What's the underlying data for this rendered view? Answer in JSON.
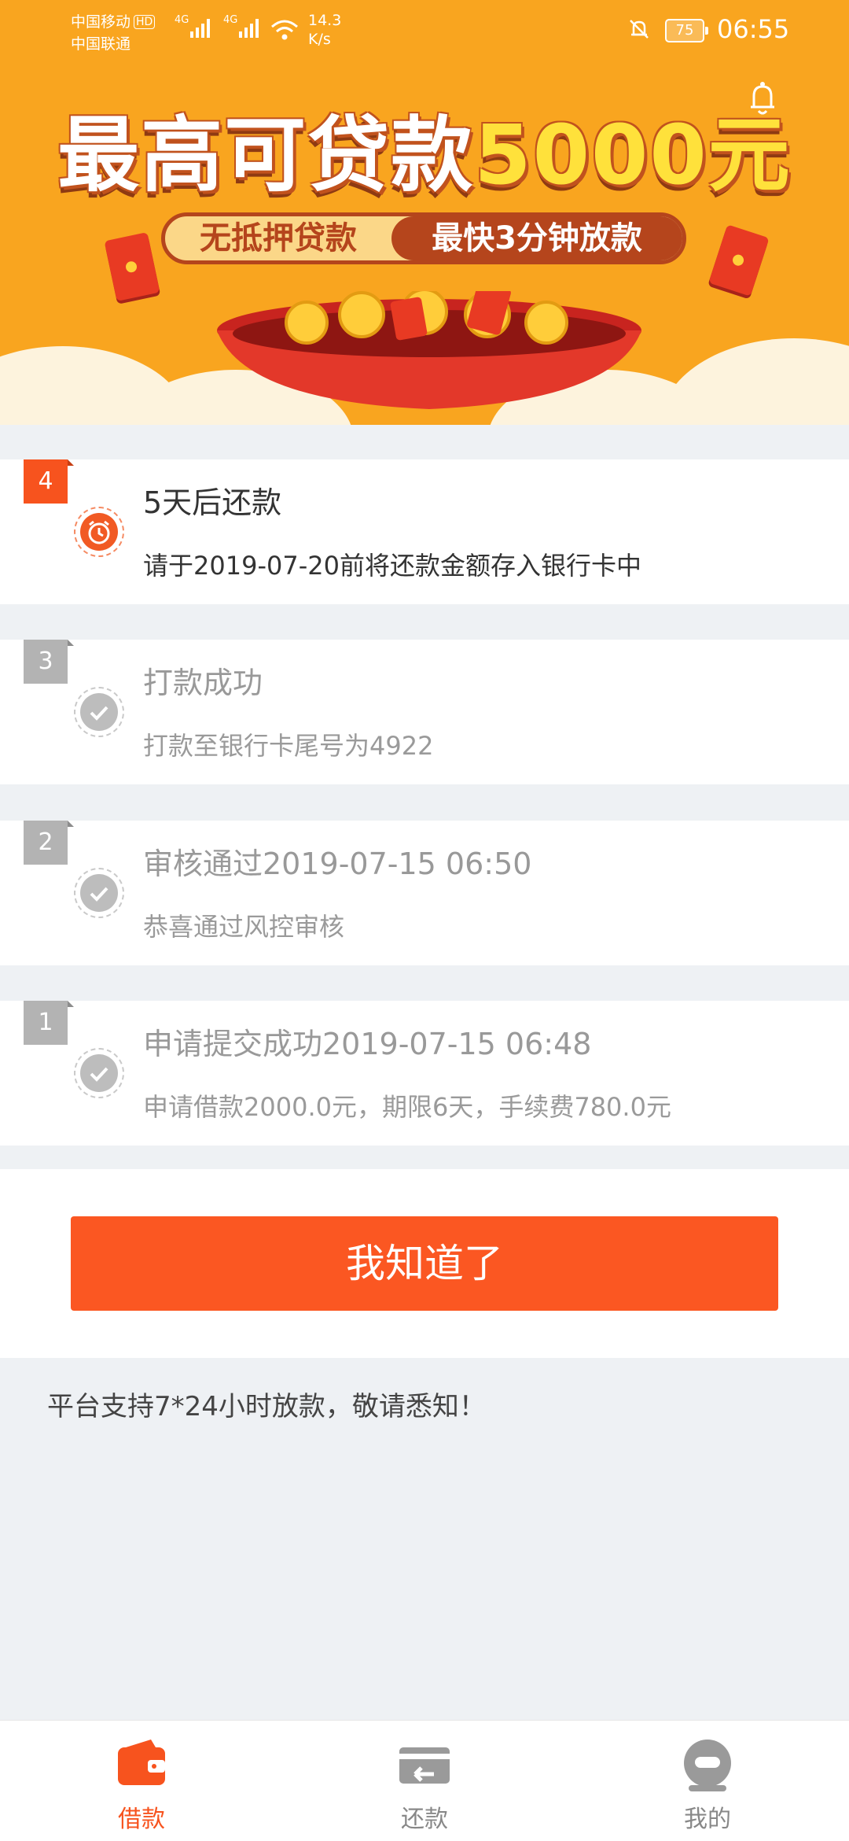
{
  "status_bar": {
    "carrier1": "中国移动",
    "hd": "HD",
    "carrier2": "中国联通",
    "sig1": "4G",
    "sig2": "4G",
    "speed_value": "14.3",
    "speed_unit": "K/s",
    "battery": "75",
    "time": "06:55"
  },
  "banner": {
    "headline": "最高可贷款",
    "amount": "5000元",
    "pill_left": "无抵押贷款",
    "pill_right": "最快3分钟放款"
  },
  "steps": [
    {
      "num": "4",
      "title": "5天后还款",
      "desc": "请于2019-07-20前将还款金额存入银行卡中",
      "state": "current",
      "icon": "alarm-clock-icon"
    },
    {
      "num": "3",
      "title": "打款成功",
      "desc": "打款至银行卡尾号为4922",
      "state": "done",
      "icon": "check-icon"
    },
    {
      "num": "2",
      "title": "审核通过2019-07-15 06:50",
      "desc": "恭喜通过风控审核",
      "state": "done",
      "icon": "check-icon"
    },
    {
      "num": "1",
      "title": "申请提交成功2019-07-15 06:48",
      "desc": "申请借款2000.0元，期限6天，手续费780.0元",
      "state": "done",
      "icon": "check-icon"
    }
  ],
  "confirm_button": "我知道了",
  "notice": "平台支持7*24小时放款，敬请悉知！",
  "tabs": [
    {
      "label": "借款",
      "icon": "wallet-icon",
      "active": true
    },
    {
      "label": "还款",
      "icon": "repay-card-icon",
      "active": false
    },
    {
      "label": "我的",
      "icon": "profile-icon",
      "active": false
    }
  ],
  "colors": {
    "brand_orange": "#fb5722",
    "banner_bg": "#f9a51f",
    "inactive_gray": "#b3b3b3"
  }
}
